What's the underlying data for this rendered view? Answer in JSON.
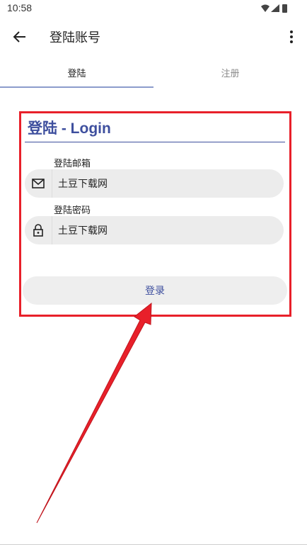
{
  "status_bar": {
    "time": "10:58"
  },
  "app_bar": {
    "title": "登陆账号"
  },
  "tabs": [
    {
      "label": "登陆"
    },
    {
      "label": "注册"
    }
  ],
  "form": {
    "title": "登陆 - Login",
    "email": {
      "label": "登陆邮箱",
      "value": "土豆下载网"
    },
    "password": {
      "label": "登陆密码",
      "value": "土豆下载网"
    },
    "submit_label": "登录"
  },
  "colors": {
    "accent": "#3e4f9e",
    "highlight": "#e8202a"
  },
  "icons": {
    "back": "arrow-back-icon",
    "more": "more-vert-icon",
    "email": "mail-icon",
    "password": "lock-icon"
  }
}
